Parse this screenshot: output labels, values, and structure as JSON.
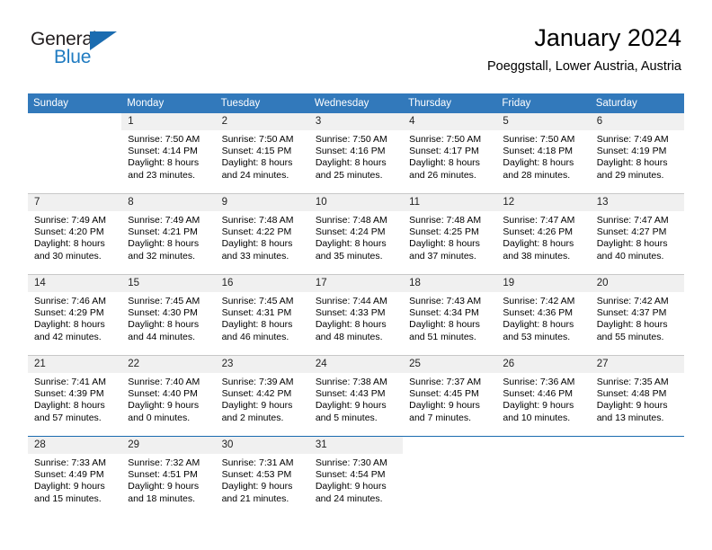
{
  "brand": {
    "name_part1": "General",
    "name_part2": "Blue"
  },
  "header": {
    "title": "January 2024",
    "location": "Poeggstall, Lower Austria, Austria"
  },
  "weekday_headers": [
    "Sunday",
    "Monday",
    "Tuesday",
    "Wednesday",
    "Thursday",
    "Friday",
    "Saturday"
  ],
  "labels": {
    "sunrise_prefix": "Sunrise:",
    "sunset_prefix": "Sunset:",
    "daylight_prefix": "Daylight:"
  },
  "colors": {
    "header_blue": "#3279bb",
    "brand_blue": "#1f7bc1",
    "triangle_blue": "#1b6cb0",
    "daynum_bg": "#f0f0f0",
    "row_divider": "#c8c8c8",
    "last_row_divider": "#1b6cb0"
  },
  "weeks": [
    [
      {
        "empty": true
      },
      {
        "day": "1",
        "line1": "Sunrise: 7:50 AM",
        "line2": "Sunset: 4:14 PM",
        "line3": "Daylight: 8 hours",
        "line4": "and 23 minutes."
      },
      {
        "day": "2",
        "line1": "Sunrise: 7:50 AM",
        "line2": "Sunset: 4:15 PM",
        "line3": "Daylight: 8 hours",
        "line4": "and 24 minutes."
      },
      {
        "day": "3",
        "line1": "Sunrise: 7:50 AM",
        "line2": "Sunset: 4:16 PM",
        "line3": "Daylight: 8 hours",
        "line4": "and 25 minutes."
      },
      {
        "day": "4",
        "line1": "Sunrise: 7:50 AM",
        "line2": "Sunset: 4:17 PM",
        "line3": "Daylight: 8 hours",
        "line4": "and 26 minutes."
      },
      {
        "day": "5",
        "line1": "Sunrise: 7:50 AM",
        "line2": "Sunset: 4:18 PM",
        "line3": "Daylight: 8 hours",
        "line4": "and 28 minutes."
      },
      {
        "day": "6",
        "line1": "Sunrise: 7:49 AM",
        "line2": "Sunset: 4:19 PM",
        "line3": "Daylight: 8 hours",
        "line4": "and 29 minutes."
      }
    ],
    [
      {
        "day": "7",
        "line1": "Sunrise: 7:49 AM",
        "line2": "Sunset: 4:20 PM",
        "line3": "Daylight: 8 hours",
        "line4": "and 30 minutes."
      },
      {
        "day": "8",
        "line1": "Sunrise: 7:49 AM",
        "line2": "Sunset: 4:21 PM",
        "line3": "Daylight: 8 hours",
        "line4": "and 32 minutes."
      },
      {
        "day": "9",
        "line1": "Sunrise: 7:48 AM",
        "line2": "Sunset: 4:22 PM",
        "line3": "Daylight: 8 hours",
        "line4": "and 33 minutes."
      },
      {
        "day": "10",
        "line1": "Sunrise: 7:48 AM",
        "line2": "Sunset: 4:24 PM",
        "line3": "Daylight: 8 hours",
        "line4": "and 35 minutes."
      },
      {
        "day": "11",
        "line1": "Sunrise: 7:48 AM",
        "line2": "Sunset: 4:25 PM",
        "line3": "Daylight: 8 hours",
        "line4": "and 37 minutes."
      },
      {
        "day": "12",
        "line1": "Sunrise: 7:47 AM",
        "line2": "Sunset: 4:26 PM",
        "line3": "Daylight: 8 hours",
        "line4": "and 38 minutes."
      },
      {
        "day": "13",
        "line1": "Sunrise: 7:47 AM",
        "line2": "Sunset: 4:27 PM",
        "line3": "Daylight: 8 hours",
        "line4": "and 40 minutes."
      }
    ],
    [
      {
        "day": "14",
        "line1": "Sunrise: 7:46 AM",
        "line2": "Sunset: 4:29 PM",
        "line3": "Daylight: 8 hours",
        "line4": "and 42 minutes."
      },
      {
        "day": "15",
        "line1": "Sunrise: 7:45 AM",
        "line2": "Sunset: 4:30 PM",
        "line3": "Daylight: 8 hours",
        "line4": "and 44 minutes."
      },
      {
        "day": "16",
        "line1": "Sunrise: 7:45 AM",
        "line2": "Sunset: 4:31 PM",
        "line3": "Daylight: 8 hours",
        "line4": "and 46 minutes."
      },
      {
        "day": "17",
        "line1": "Sunrise: 7:44 AM",
        "line2": "Sunset: 4:33 PM",
        "line3": "Daylight: 8 hours",
        "line4": "and 48 minutes."
      },
      {
        "day": "18",
        "line1": "Sunrise: 7:43 AM",
        "line2": "Sunset: 4:34 PM",
        "line3": "Daylight: 8 hours",
        "line4": "and 51 minutes."
      },
      {
        "day": "19",
        "line1": "Sunrise: 7:42 AM",
        "line2": "Sunset: 4:36 PM",
        "line3": "Daylight: 8 hours",
        "line4": "and 53 minutes."
      },
      {
        "day": "20",
        "line1": "Sunrise: 7:42 AM",
        "line2": "Sunset: 4:37 PM",
        "line3": "Daylight: 8 hours",
        "line4": "and 55 minutes."
      }
    ],
    [
      {
        "day": "21",
        "line1": "Sunrise: 7:41 AM",
        "line2": "Sunset: 4:39 PM",
        "line3": "Daylight: 8 hours",
        "line4": "and 57 minutes."
      },
      {
        "day": "22",
        "line1": "Sunrise: 7:40 AM",
        "line2": "Sunset: 4:40 PM",
        "line3": "Daylight: 9 hours",
        "line4": "and 0 minutes."
      },
      {
        "day": "23",
        "line1": "Sunrise: 7:39 AM",
        "line2": "Sunset: 4:42 PM",
        "line3": "Daylight: 9 hours",
        "line4": "and 2 minutes."
      },
      {
        "day": "24",
        "line1": "Sunrise: 7:38 AM",
        "line2": "Sunset: 4:43 PM",
        "line3": "Daylight: 9 hours",
        "line4": "and 5 minutes."
      },
      {
        "day": "25",
        "line1": "Sunrise: 7:37 AM",
        "line2": "Sunset: 4:45 PM",
        "line3": "Daylight: 9 hours",
        "line4": "and 7 minutes."
      },
      {
        "day": "26",
        "line1": "Sunrise: 7:36 AM",
        "line2": "Sunset: 4:46 PM",
        "line3": "Daylight: 9 hours",
        "line4": "and 10 minutes."
      },
      {
        "day": "27",
        "line1": "Sunrise: 7:35 AM",
        "line2": "Sunset: 4:48 PM",
        "line3": "Daylight: 9 hours",
        "line4": "and 13 minutes."
      }
    ],
    [
      {
        "day": "28",
        "line1": "Sunrise: 7:33 AM",
        "line2": "Sunset: 4:49 PM",
        "line3": "Daylight: 9 hours",
        "line4": "and 15 minutes."
      },
      {
        "day": "29",
        "line1": "Sunrise: 7:32 AM",
        "line2": "Sunset: 4:51 PM",
        "line3": "Daylight: 9 hours",
        "line4": "and 18 minutes."
      },
      {
        "day": "30",
        "line1": "Sunrise: 7:31 AM",
        "line2": "Sunset: 4:53 PM",
        "line3": "Daylight: 9 hours",
        "line4": "and 21 minutes."
      },
      {
        "day": "31",
        "line1": "Sunrise: 7:30 AM",
        "line2": "Sunset: 4:54 PM",
        "line3": "Daylight: 9 hours",
        "line4": "and 24 minutes."
      },
      {
        "empty": true
      },
      {
        "empty": true
      },
      {
        "empty": true
      }
    ]
  ]
}
